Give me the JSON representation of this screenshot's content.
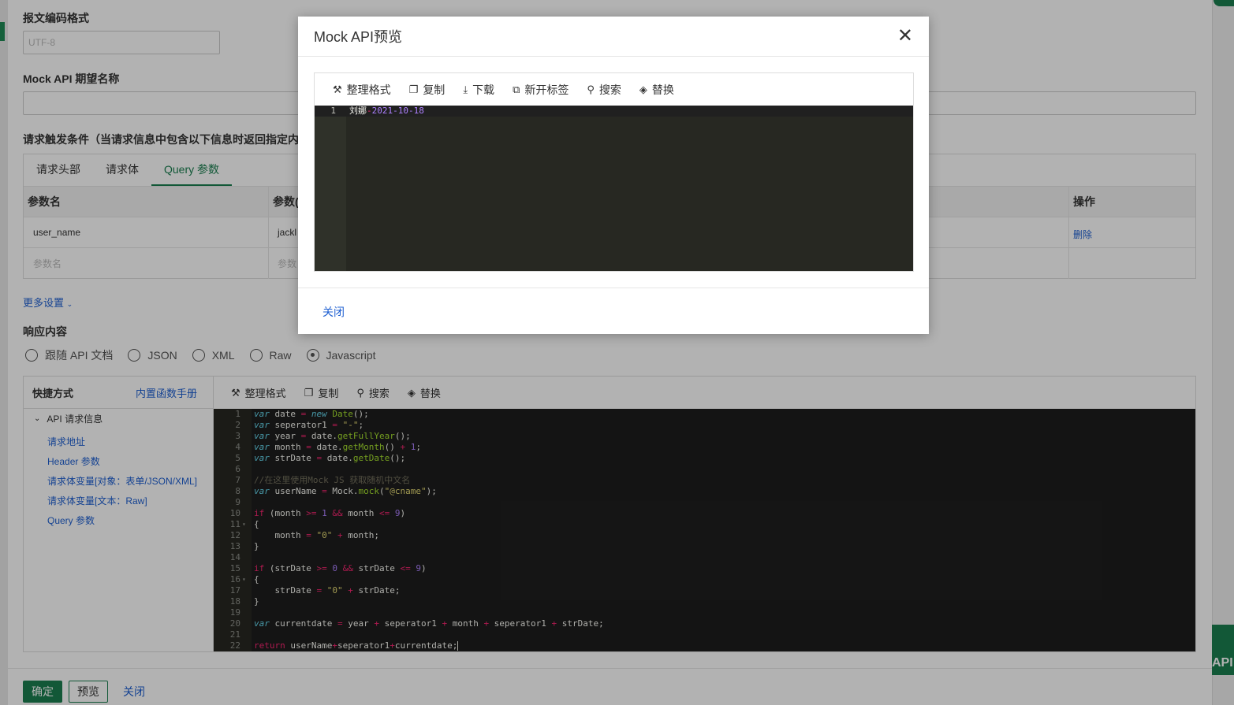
{
  "form": {
    "encoding_label": "报文编码格式",
    "encoding_placeholder": "UTF-8",
    "name_label": "Mock API 期望名称",
    "trigger_label": "请求触发条件（当请求信息中包含以下信息时返回指定内",
    "tabs": [
      "请求头部",
      "请求体",
      "Query 参数"
    ],
    "active_tab": "Query 参数",
    "table": {
      "headers": {
        "name": "参数名",
        "value": "参数(",
        "action": "操作"
      },
      "rows": [
        {
          "name": "user_name",
          "value": "jackl",
          "action": "删除"
        }
      ],
      "new_row": {
        "name_placeholder": "参数名",
        "value_placeholder": "参数"
      }
    },
    "more_settings": "更多设置",
    "response_label": "响应内容",
    "response_types": [
      "跟随 API 文档",
      "JSON",
      "XML",
      "Raw",
      "Javascript"
    ],
    "selected_response_type": "Javascript"
  },
  "shortcuts": {
    "title": "快捷方式",
    "manual_link": "内置函数手册",
    "group": "API 请求信息",
    "items": [
      "请求地址",
      "Header 参数",
      "请求体变量[对象：表单/JSON/XML]",
      "请求体变量[文本：Raw]",
      "Query 参数"
    ]
  },
  "editor_toolbar": {
    "format": "整理格式",
    "copy": "复制",
    "search": "搜索",
    "replace": "替换"
  },
  "code_lines": [
    "var date = new Date();",
    "var seperator1 = \"-\";",
    "var year = date.getFullYear();",
    "var month = date.getMonth() + 1;",
    "var strDate = date.getDate();",
    "",
    "//在这里使用Mock JS 获取随机中文名",
    "var userName = Mock.mock(\"@cname\");",
    "",
    "if (month >= 1 && month <= 9)",
    "{",
    "    month = \"0\" + month;",
    "}",
    "",
    "if (strDate >= 0 && strDate <= 9)",
    "{",
    "    strDate = \"0\" + strDate;",
    "}",
    "",
    "var currentdate = year + seperator1 + month + seperator1 + strDate;",
    "",
    "return userName+seperator1+currentdate;"
  ],
  "footer": {
    "confirm": "确定",
    "preview": "预览",
    "close": "关闭"
  },
  "side_tab": "API",
  "modal": {
    "title": "Mock API预览",
    "toolbar": {
      "format": "整理格式",
      "copy": "复制",
      "download": "下载",
      "new_tab": "新开标签",
      "search": "搜索",
      "replace": "替换"
    },
    "preview_line_number": "1",
    "preview_name": "刘娜",
    "preview_sep": "-",
    "preview_date": "2021-10-18",
    "close_button": "关闭"
  },
  "colors": {
    "primary": "#1a7f50",
    "link": "#1e5fd1",
    "editor_bg": "#272822"
  }
}
